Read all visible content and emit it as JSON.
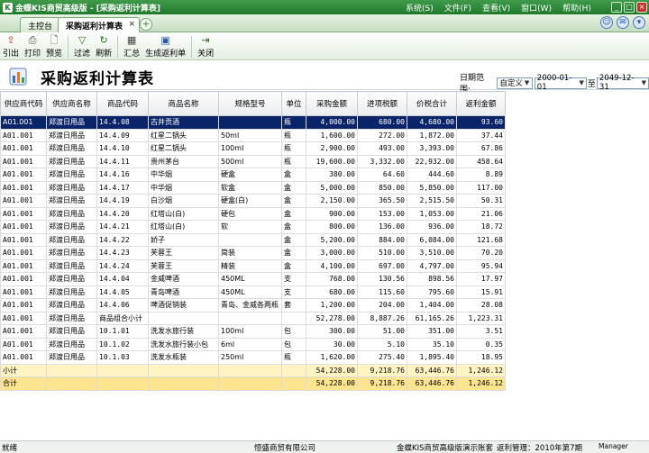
{
  "window": {
    "title": "金蝶KIS商贸高级版 - [采购返利计算表]",
    "menus": [
      "系统(S)",
      "文件(F)",
      "查看(V)",
      "窗口(W)",
      "帮助(H)"
    ]
  },
  "tabs": {
    "home": "主控台",
    "active": "采购返利计算表"
  },
  "toolbar": {
    "buttons": [
      {
        "label": "引出",
        "icon": "export-icon"
      },
      {
        "label": "打印",
        "icon": "print-icon"
      },
      {
        "label": "预览",
        "icon": "preview-icon"
      },
      {
        "label": "过滤",
        "icon": "filter-icon"
      },
      {
        "label": "刷新",
        "icon": "refresh-icon"
      },
      {
        "label": "汇总",
        "icon": "summary-icon"
      },
      {
        "label": "生成返利单",
        "icon": "generate-rebate-icon"
      },
      {
        "label": "关闭",
        "icon": "close-icon"
      }
    ]
  },
  "header": {
    "title": "采购返利计算表",
    "date_label": "日期范围:",
    "range_type": "自定义",
    "date_from": "2000-01-01",
    "to_label": "至",
    "date_to": "2049-12-31"
  },
  "grid": {
    "columns": [
      "供应商代码",
      "供应商名称",
      "商品代码",
      "商品名称",
      "规格型号",
      "单位",
      "采购金额",
      "进项税额",
      "价税合计",
      "返利金额"
    ],
    "rows": [
      [
        "A01.001",
        "郑渡日用品",
        "14.4.08",
        "古井贡酒",
        "",
        "瓶",
        "4,000.00",
        "680.00",
        "4,680.00",
        "93.60"
      ],
      [
        "A01.001",
        "郑渡日用品",
        "14.4.09",
        "红星二锅头",
        "50ml",
        "瓶",
        "1,600.00",
        "272.00",
        "1,872.00",
        "37.44"
      ],
      [
        "A01.001",
        "郑渡日用品",
        "14.4.10",
        "红星二锅头",
        "100ml",
        "瓶",
        "2,900.00",
        "493.00",
        "3,393.00",
        "67.86"
      ],
      [
        "A01.001",
        "郑渡日用品",
        "14.4.11",
        "贵州茅台",
        "500ml",
        "瓶",
        "19,600.00",
        "3,332.00",
        "22,932.00",
        "458.64"
      ],
      [
        "A01.001",
        "郑渡日用品",
        "14.4.16",
        "中华烟",
        "硬盒",
        "盒",
        "380.00",
        "64.60",
        "444.60",
        "8.89"
      ],
      [
        "A01.001",
        "郑渡日用品",
        "14.4.17",
        "中华烟",
        "软盒",
        "盒",
        "5,000.00",
        "850.00",
        "5,850.00",
        "117.00"
      ],
      [
        "A01.001",
        "郑渡日用品",
        "14.4.19",
        "白沙烟",
        "硬盒(白)",
        "盒",
        "2,150.00",
        "365.50",
        "2,515.50",
        "50.31"
      ],
      [
        "A01.001",
        "郑渡日用品",
        "14.4.20",
        "红塔山(白)",
        "硬包",
        "盒",
        "900.00",
        "153.00",
        "1,053.00",
        "21.06"
      ],
      [
        "A01.001",
        "郑渡日用品",
        "14.4.21",
        "红塔山(白)",
        "软",
        "盒",
        "800.00",
        "136.00",
        "936.00",
        "18.72"
      ],
      [
        "A01.001",
        "郑渡日用品",
        "14.4.22",
        "娇子",
        "",
        "盒",
        "5,200.00",
        "884.00",
        "6,084.00",
        "121.68"
      ],
      [
        "A01.001",
        "郑渡日用品",
        "14.4.23",
        "芙蓉王",
        "简装",
        "盒",
        "3,000.00",
        "510.00",
        "3,510.00",
        "70.20"
      ],
      [
        "A01.001",
        "郑渡日用品",
        "14.4.24",
        "芙蓉王",
        "精装",
        "盒",
        "4,100.00",
        "697.00",
        "4,797.00",
        "95.94"
      ],
      [
        "A01.001",
        "郑渡日用品",
        "14.4.04",
        "金威啤酒",
        "450ML",
        "支",
        "768.00",
        "130.56",
        "898.56",
        "17.97"
      ],
      [
        "A01.001",
        "郑渡日用品",
        "14.4.05",
        "青岛啤酒",
        "450ML",
        "支",
        "680.00",
        "115.60",
        "795.60",
        "15.91"
      ],
      [
        "A01.001",
        "郑渡日用品",
        "14.4.06",
        "啤酒促销装",
        "青岛、金威各两瓶",
        "套",
        "1,200.00",
        "204.00",
        "1,404.00",
        "28.08"
      ],
      [
        "A01.001",
        "郑渡日用品",
        "商品组合小计",
        "",
        "",
        "",
        "52,278.00",
        "8,887.26",
        "61,165.26",
        "1,223.31"
      ],
      [
        "A01.001",
        "郑渡日用品",
        "10.1.01",
        "洗发水旅行装",
        "100ml",
        "包",
        "300.00",
        "51.00",
        "351.00",
        "3.51"
      ],
      [
        "A01.001",
        "郑渡日用品",
        "10.1.02",
        "洗发水旅行装小包",
        "6ml",
        "包",
        "30.00",
        "5.10",
        "35.10",
        "0.35"
      ],
      [
        "A01.001",
        "郑渡日用品",
        "10.1.03",
        "洗发水瓶装",
        "250ml",
        "瓶",
        "1,620.00",
        "275.40",
        "1,895.40",
        "18.95"
      ]
    ],
    "subtotal": [
      "小计",
      "",
      "",
      "",
      "",
      "",
      "54,228.00",
      "9,218.76",
      "63,446.76",
      "1,246.12"
    ],
    "total": [
      "合计",
      "",
      "",
      "",
      "",
      "",
      "54,228.00",
      "9,218.76",
      "63,446.76",
      "1,246.12"
    ]
  },
  "status": {
    "state": "就绪",
    "company": "恒盛商贸有限公司",
    "product": "金蝶KIS商贸高级版演示账套",
    "period": "返利管理：2010年第7期",
    "user": "Manager"
  },
  "colors": {
    "titlebar": "#1f7a2c",
    "selected_row": "#0a246a",
    "subtotal_row": "#fff4c2",
    "total_row": "#fde48f"
  }
}
